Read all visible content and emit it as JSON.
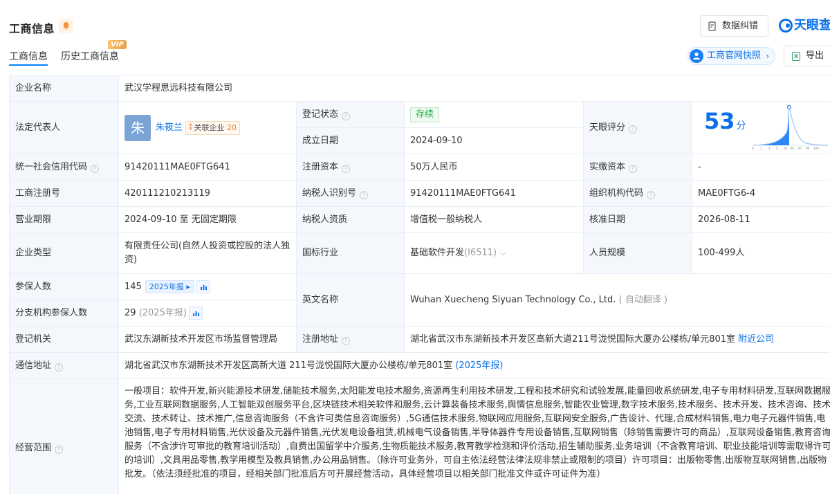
{
  "header": {
    "title": "工商信息",
    "tabs": [
      "工商信息",
      "历史工商信息"
    ],
    "vip": "VIP",
    "correction": "数据纠错",
    "logo": "天眼查",
    "snapshot": "工商官网快照",
    "export": "导出"
  },
  "rows": {
    "company_name": {
      "label": "企业名称",
      "value": "武汉学程思远科技有限公司"
    },
    "legal_rep": {
      "label": "法定代表人",
      "avatar": "朱",
      "name": "朱筱兰",
      "related_label": "关联企业",
      "related_count": "20"
    },
    "reg_status": {
      "label": "登记状态",
      "value": "存续"
    },
    "tianyan": {
      "label": "天眼评分",
      "score": "53",
      "unit": "分",
      "ticks": [
        "0",
        "1",
        "3",
        "5",
        "8",
        "10",
        "15",
        "25",
        "50",
        "65",
        "97",
        "99",
        "100"
      ]
    },
    "founded": {
      "label": "成立日期",
      "value": "2024-09-10"
    },
    "uscc": {
      "label": "统一社会信用代码",
      "value": "91420111MAE0FTG641"
    },
    "reg_capital": {
      "label": "注册资本",
      "value": "50万人民币"
    },
    "paid_capital": {
      "label": "实缴资本",
      "value": "-"
    },
    "reg_no": {
      "label": "工商注册号",
      "value": "420111210213119"
    },
    "taxpayer_id": {
      "label": "纳税人识别号",
      "value": "91420111MAE0FTG641"
    },
    "org_code": {
      "label": "组织机构代码",
      "value": "MAE0FTG6-4"
    },
    "term": {
      "label": "营业期限",
      "value": "2024-09-10 至 无固定期限"
    },
    "taxpayer_qual": {
      "label": "纳税人资质",
      "value": "增值税一般纳税人"
    },
    "approval_date": {
      "label": "核准日期",
      "value": "2026-08-11"
    },
    "company_type": {
      "label": "企业类型",
      "value": "有限责任公司(自然人投资或控股的法人独资)"
    },
    "industry": {
      "label": "国标行业",
      "value": "基础软件开发",
      "code": "(I6511)"
    },
    "staff": {
      "label": "人员规模",
      "value": "100-499人"
    },
    "insured": {
      "label": "参保人数",
      "value": "145",
      "badge": "2025年报"
    },
    "english": {
      "label": "英文名称",
      "value": "Wuhan Xuecheng Siyuan Technology Co., Ltd.",
      "note": "( 自动翻译 )"
    },
    "branch_insured": {
      "label": "分支机构参保人数",
      "value": "29",
      "note": "(2025年报)"
    },
    "authority": {
      "label": "登记机关",
      "value": "武汉东湖新技术开发区市场监督管理局"
    },
    "reg_address": {
      "label": "注册地址",
      "value": "湖北省武汉市东湖新技术开发区高新大道211号泷悦国际大厦办公楼栋/单元801室",
      "link": "附近公司"
    },
    "mail_address": {
      "label": "通信地址",
      "value": "湖北省武汉市东湖新技术开发区高新大道 211号泷悦国际大厦办公楼栋/单元801室",
      "link": "(2025年报)"
    },
    "scope": {
      "label": "经营范围",
      "value": "一般项目：软件开发,新兴能源技术研发,储能技术服务,太阳能发电技术服务,资源再生利用技术研发,工程和技术研究和试验发展,能量回收系统研发,电子专用材料研发,互联网数据服务,工业互联网数据服务,人工智能双创服务平台,区块链技术相关软件和服务,云计算装备技术服务,舆情信息服务,智能农业管理,数字技术服务,技术服务、技术开发、技术咨询、技术交流、技术转让、技术推广,信息咨询服务（不含许可类信息咨询服务）,5G通信技术服务,物联网应用服务,互联网安全服务,广告设计、代理,合成材料销售,电力电子元器件销售,电池销售,电子专用材料销售,光伏设备及元器件销售,光伏发电设备租赁,机械电气设备销售,半导体器件专用设备销售,互联网销售（除销售需要许可的商品）,互联网设备销售,教育咨询服务（不含涉许可审批的教育培训活动）,自费出国留学中介服务,生物质能技术服务,教育教学检测和评价活动,招生辅助服务,业务培训（不含教育培训、职业技能培训等需取得许可的培训）,文具用品零售,教学用模型及教具销售,办公用品销售。（除许可业务外，可自主依法经营法律法规非禁止或限制的项目）许可项目：出版物零售,出版物互联网销售,出版物批发。（依法须经批准的项目，经相关部门批准后方可开展经营活动，具体经营项目以相关部门批准文件或许可证件为准）"
    }
  }
}
